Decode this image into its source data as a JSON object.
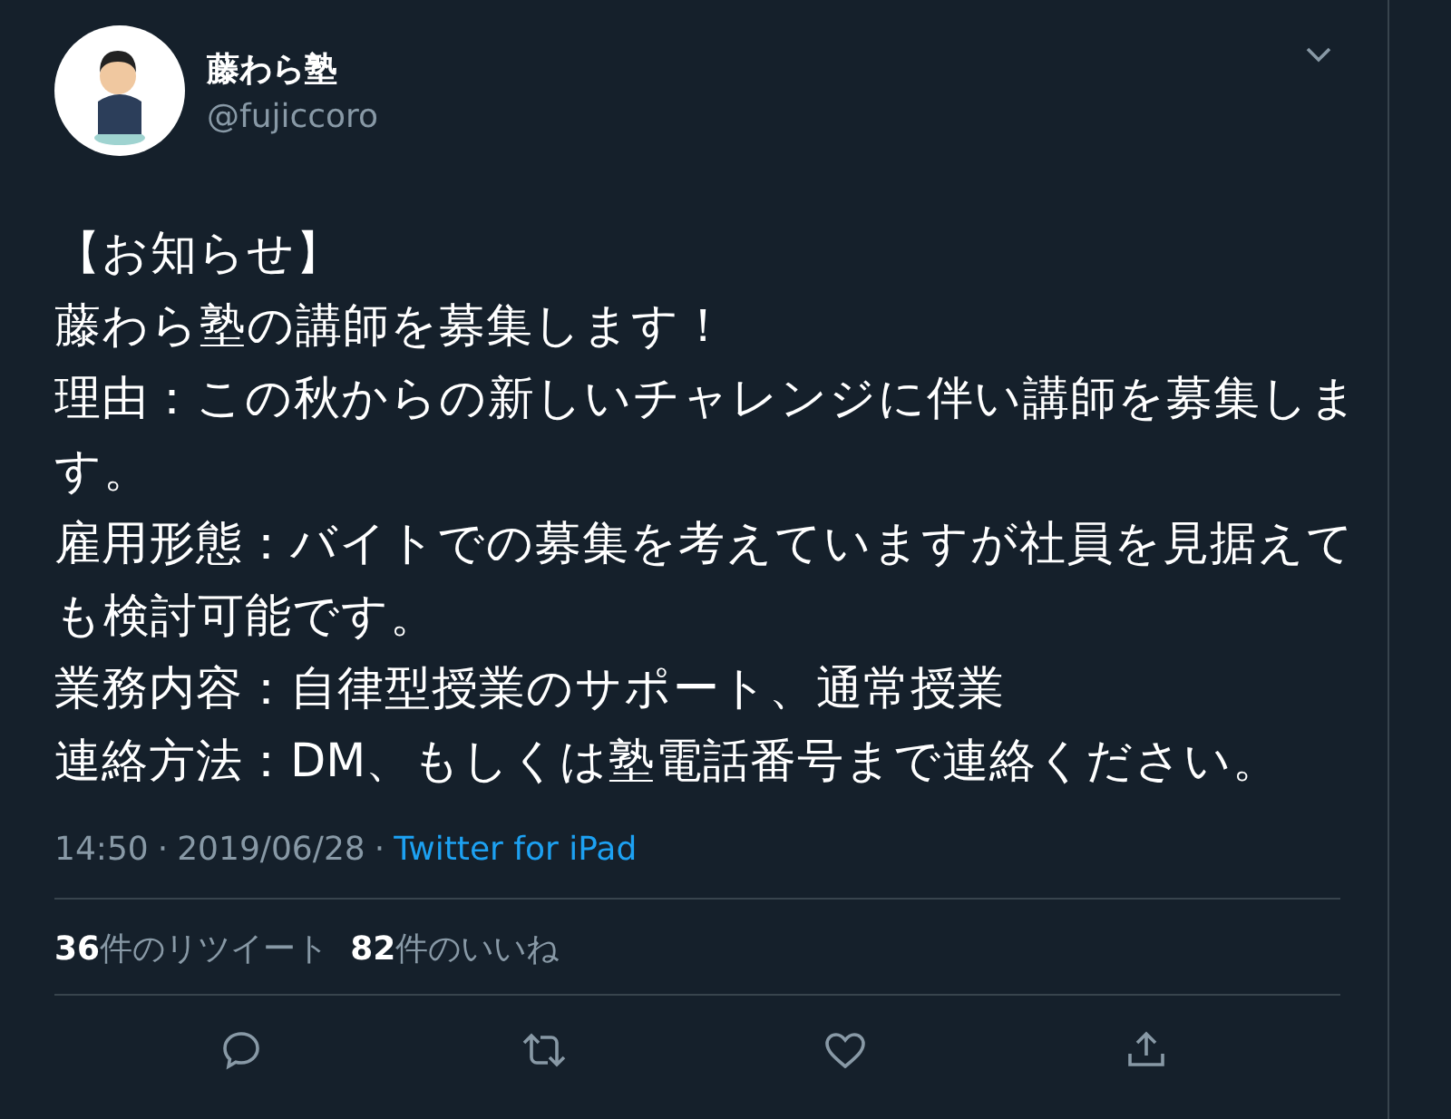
{
  "author": {
    "name": "藤わら塾",
    "handle": "@fujiccoro"
  },
  "body": [
    "【お知らせ】",
    "藤わら塾の講師を募集します！",
    "理由：この秋からの新しいチャレンジに伴い講師を募集します。",
    "雇用形態：バイトでの募集を考えていますが社員を見据えても検討可能です。",
    "業務内容：自律型授業のサポート、通常授業",
    "連絡方法：DM、もしくは塾電話番号まで連絡ください。"
  ],
  "meta": {
    "time": "14:50",
    "separator_1": "·",
    "date": "2019/06/28",
    "separator_2": "·",
    "source": "Twitter for iPad"
  },
  "stats": [
    {
      "text": "**36**件のリツイート"
    },
    {
      "text": "**82**件のいいね"
    }
  ],
  "actions": [
    {
      "kind": "reply"
    },
    {
      "kind": "retweet"
    },
    {
      "kind": "like"
    },
    {
      "kind": "share"
    }
  ]
}
